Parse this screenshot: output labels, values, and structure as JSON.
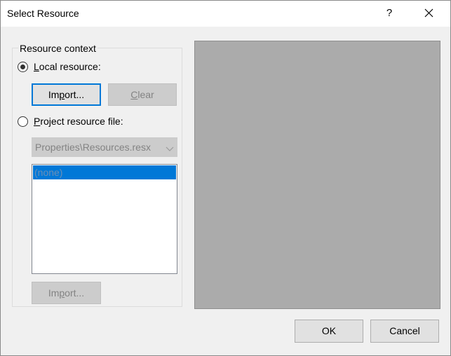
{
  "dialog": {
    "title": "Select Resource",
    "help_glyph": "?",
    "close_icon": "close-icon"
  },
  "resource_context": {
    "legend": "Resource context",
    "local_resource": {
      "label_prefix": "",
      "label_mnemonic": "L",
      "label_rest": "ocal resource:",
      "selected": true
    },
    "import_button": {
      "prefix": "Im",
      "mnemonic": "p",
      "rest": "ort..."
    },
    "clear_button": {
      "mnemonic": "C",
      "rest": "lear"
    },
    "project_resource": {
      "label_mnemonic": "P",
      "label_rest": "roject resource file:",
      "selected": false
    },
    "resource_file_select": {
      "value": "Properties\\Resources.resx"
    },
    "resource_list": {
      "items": [
        "(none)"
      ],
      "selected_index": 0
    },
    "project_import_button": {
      "prefix": "Im",
      "mnemonic": "p",
      "rest": "ort..."
    }
  },
  "footer": {
    "ok_label": "OK",
    "cancel_label": "Cancel"
  },
  "colors": {
    "accent": "#0078d7",
    "dialog_background": "#f0f0f0",
    "preview_background": "#ababab"
  }
}
